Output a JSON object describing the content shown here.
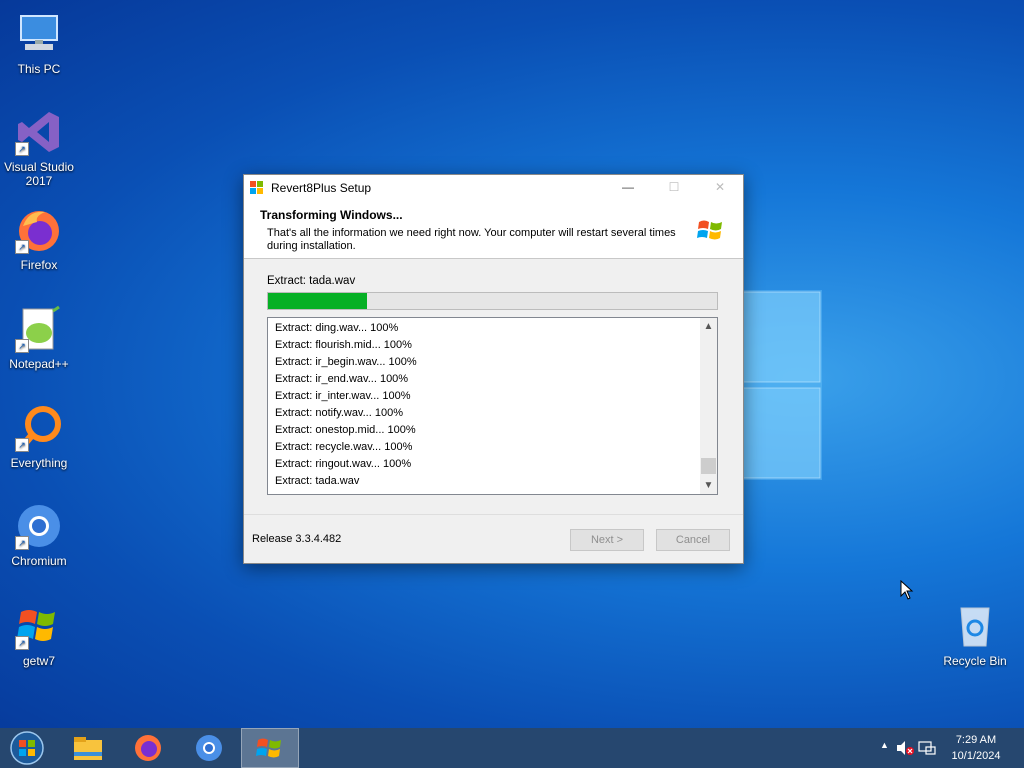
{
  "desktop": {
    "icons": [
      {
        "label": "This PC",
        "icon": "computer-icon"
      },
      {
        "label": "Visual Studio 2017",
        "icon": "visual-studio-icon",
        "shortcut": true
      },
      {
        "label": "Firefox",
        "icon": "firefox-icon",
        "shortcut": true
      },
      {
        "label": "Notepad++",
        "icon": "notepadpp-icon",
        "shortcut": true
      },
      {
        "label": "Everything",
        "icon": "everything-icon",
        "shortcut": true
      },
      {
        "label": "Chromium",
        "icon": "chromium-icon",
        "shortcut": true
      },
      {
        "label": "getw7",
        "icon": "windows7-icon",
        "shortcut": true
      },
      {
        "label": "Recycle Bin",
        "icon": "recycle-bin-icon"
      }
    ]
  },
  "dialog": {
    "title": "Revert8Plus Setup",
    "controls": {
      "minimize": "—",
      "maximize": "☐",
      "close": "✕"
    },
    "header_title": "Transforming Windows...",
    "header_subtitle": "That's all the information we need right now. Your computer will restart several times during installation.",
    "current_action": "Extract: tada.wav",
    "progress": 0.22,
    "log": [
      "Extract: ding.wav... 100%",
      "Extract: flourish.mid... 100%",
      "Extract: ir_begin.wav... 100%",
      "Extract: ir_end.wav... 100%",
      "Extract: ir_inter.wav... 100%",
      "Extract: notify.wav... 100%",
      "Extract: onestop.mid... 100%",
      "Extract: recycle.wav... 100%",
      "Extract: ringout.wav... 100%",
      "Extract: tada.wav"
    ],
    "release": "Release 3.3.4.482",
    "next_label": "Next >",
    "cancel_label": "Cancel"
  },
  "taskbar": {
    "pinned": [
      "file-explorer-icon",
      "firefox-icon",
      "chromium-icon",
      "setup-icon"
    ],
    "time": "7:29 AM",
    "date": "10/1/2024"
  },
  "colors": {
    "progress": "#06b025",
    "taskbar": "#26476f",
    "wallpaper": "#1577d8"
  }
}
